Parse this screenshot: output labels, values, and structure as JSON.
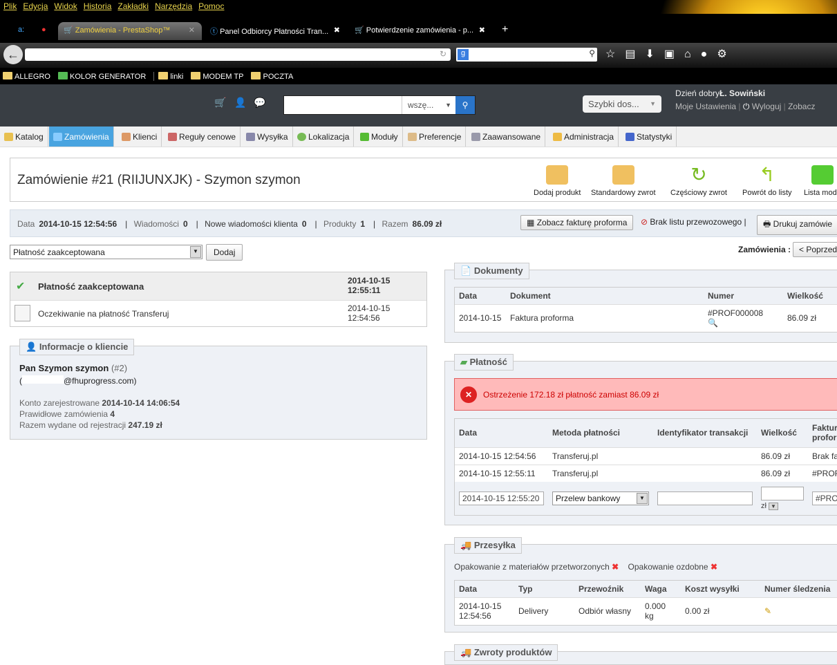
{
  "browser": {
    "menu": [
      "Plik",
      "Edycja",
      "Widok",
      "Historia",
      "Zakładki",
      "Narzędzia",
      "Pomoc"
    ],
    "tabs": [
      {
        "title": "Zamówienia - PrestaShop™",
        "active": true
      },
      {
        "title": "Panel Odbiorcy Płatności Tran..."
      },
      {
        "title": "Potwierdzenie zamówienia - p..."
      }
    ],
    "bookmarks": [
      "ALLEGRO",
      "KOLOR GENERATOR",
      "linki",
      "MODEM TP",
      "POCZTA"
    ]
  },
  "header": {
    "search_scope": "wszę...",
    "quick_access": "Szybki dos...",
    "greeting": "Dzień dobry",
    "user": "Ł. Sowiński",
    "links": [
      "Moje Ustawienia",
      "Wyloguj",
      "Zobacz"
    ]
  },
  "nav": [
    "Katalog",
    "Zamówienia",
    "Klienci",
    "Reguły cenowe",
    "Wysyłka",
    "Lokalizacja",
    "Moduły",
    "Preferencje",
    "Zaawansowane",
    "Administracja",
    "Statystyki"
  ],
  "toolbar": {
    "title": "Zamówienie #21 (RIIJUNXJK) - Szymon szymon",
    "buttons": [
      "Dodaj produkt",
      "Standardowy zwrot",
      "Częściowy zwrot",
      "Powrót do listy",
      "Lista modu"
    ]
  },
  "info": {
    "date_label": "Data",
    "date": "2014-10-15 12:54:56",
    "messages_label": "Wiadomości",
    "messages": "0",
    "new_messages_label": "Nowe wiadomości klienta",
    "new_messages": "0",
    "products_label": "Produkty",
    "products": "1",
    "total_label": "Razem",
    "total": "86.09 zł",
    "invoice_button": "Zobacz fakturę proforma",
    "no_waybill": "Brak listu przewozowego |",
    "print_button": "Drukuj zamówie"
  },
  "status": {
    "selected": "Płatność zaakceptowana",
    "add_button": "Dodaj",
    "orders_label": "Zamówienia :",
    "prev_button": "< Poprzed",
    "history": [
      {
        "label": "Płatność zaakceptowana",
        "date": "2014-10-15 12:55:11"
      },
      {
        "label": "Oczekiwanie na płatność Transferuj",
        "date": "2014-10-15 12:54:56"
      }
    ]
  },
  "customer": {
    "legend": "Informacje o kliencie",
    "name": "Pan Szymon szymon",
    "id": "(#2)",
    "email": "@fhuprogress.com)",
    "registered_label": "Konto zarejestrowane",
    "registered": "2014-10-14 14:06:54",
    "valid_orders_label": "Prawidłowe zamówienia",
    "valid_orders": "4",
    "spent_label": "Razem wydane od rejestracji",
    "spent": "247.19 zł"
  },
  "documents": {
    "legend": "Dokumenty",
    "headers": [
      "Data",
      "Dokument",
      "Numer",
      "Wielkość"
    ],
    "rows": [
      [
        "2014-10-15",
        "Faktura proforma",
        "#PROF000008",
        "86.09 zł"
      ]
    ]
  },
  "payment": {
    "legend": "Płatność",
    "warning": "Ostrzeżenie 172.18 zł płatność zamiast 86.09 zł",
    "headers": [
      "Data",
      "Metoda płatności",
      "Identyfikator transakcji",
      "Wielkość",
      "Faktura proform"
    ],
    "rows": [
      [
        "2014-10-15 12:54:56",
        "Transferuj.pl",
        "",
        "86.09 zł",
        "Brak fak"
      ],
      [
        "2014-10-15 12:55:11",
        "Transferuj.pl",
        "",
        "86.09 zł",
        "#PROF"
      ]
    ],
    "new_date": "2014-10-15 12:55:20",
    "new_method": "Przelew bankowy",
    "currency": "zł",
    "new_invoice": "#PROF"
  },
  "shipping": {
    "legend": "Przesyłka",
    "recycled": "Opakowanie z materiałów przetworzonych",
    "gift": "Opakowanie ozdobne",
    "headers": [
      "Data",
      "Typ",
      "Przewoźnik",
      "Waga",
      "Koszt wysyłki",
      "Numer śledzenia"
    ],
    "rows": [
      [
        "2014-10-15 12:54:56",
        "Delivery",
        "Odbiór własny",
        "0.000 kg",
        "0.00 zł"
      ]
    ]
  },
  "returns": {
    "legend": "Zwroty produktów"
  }
}
